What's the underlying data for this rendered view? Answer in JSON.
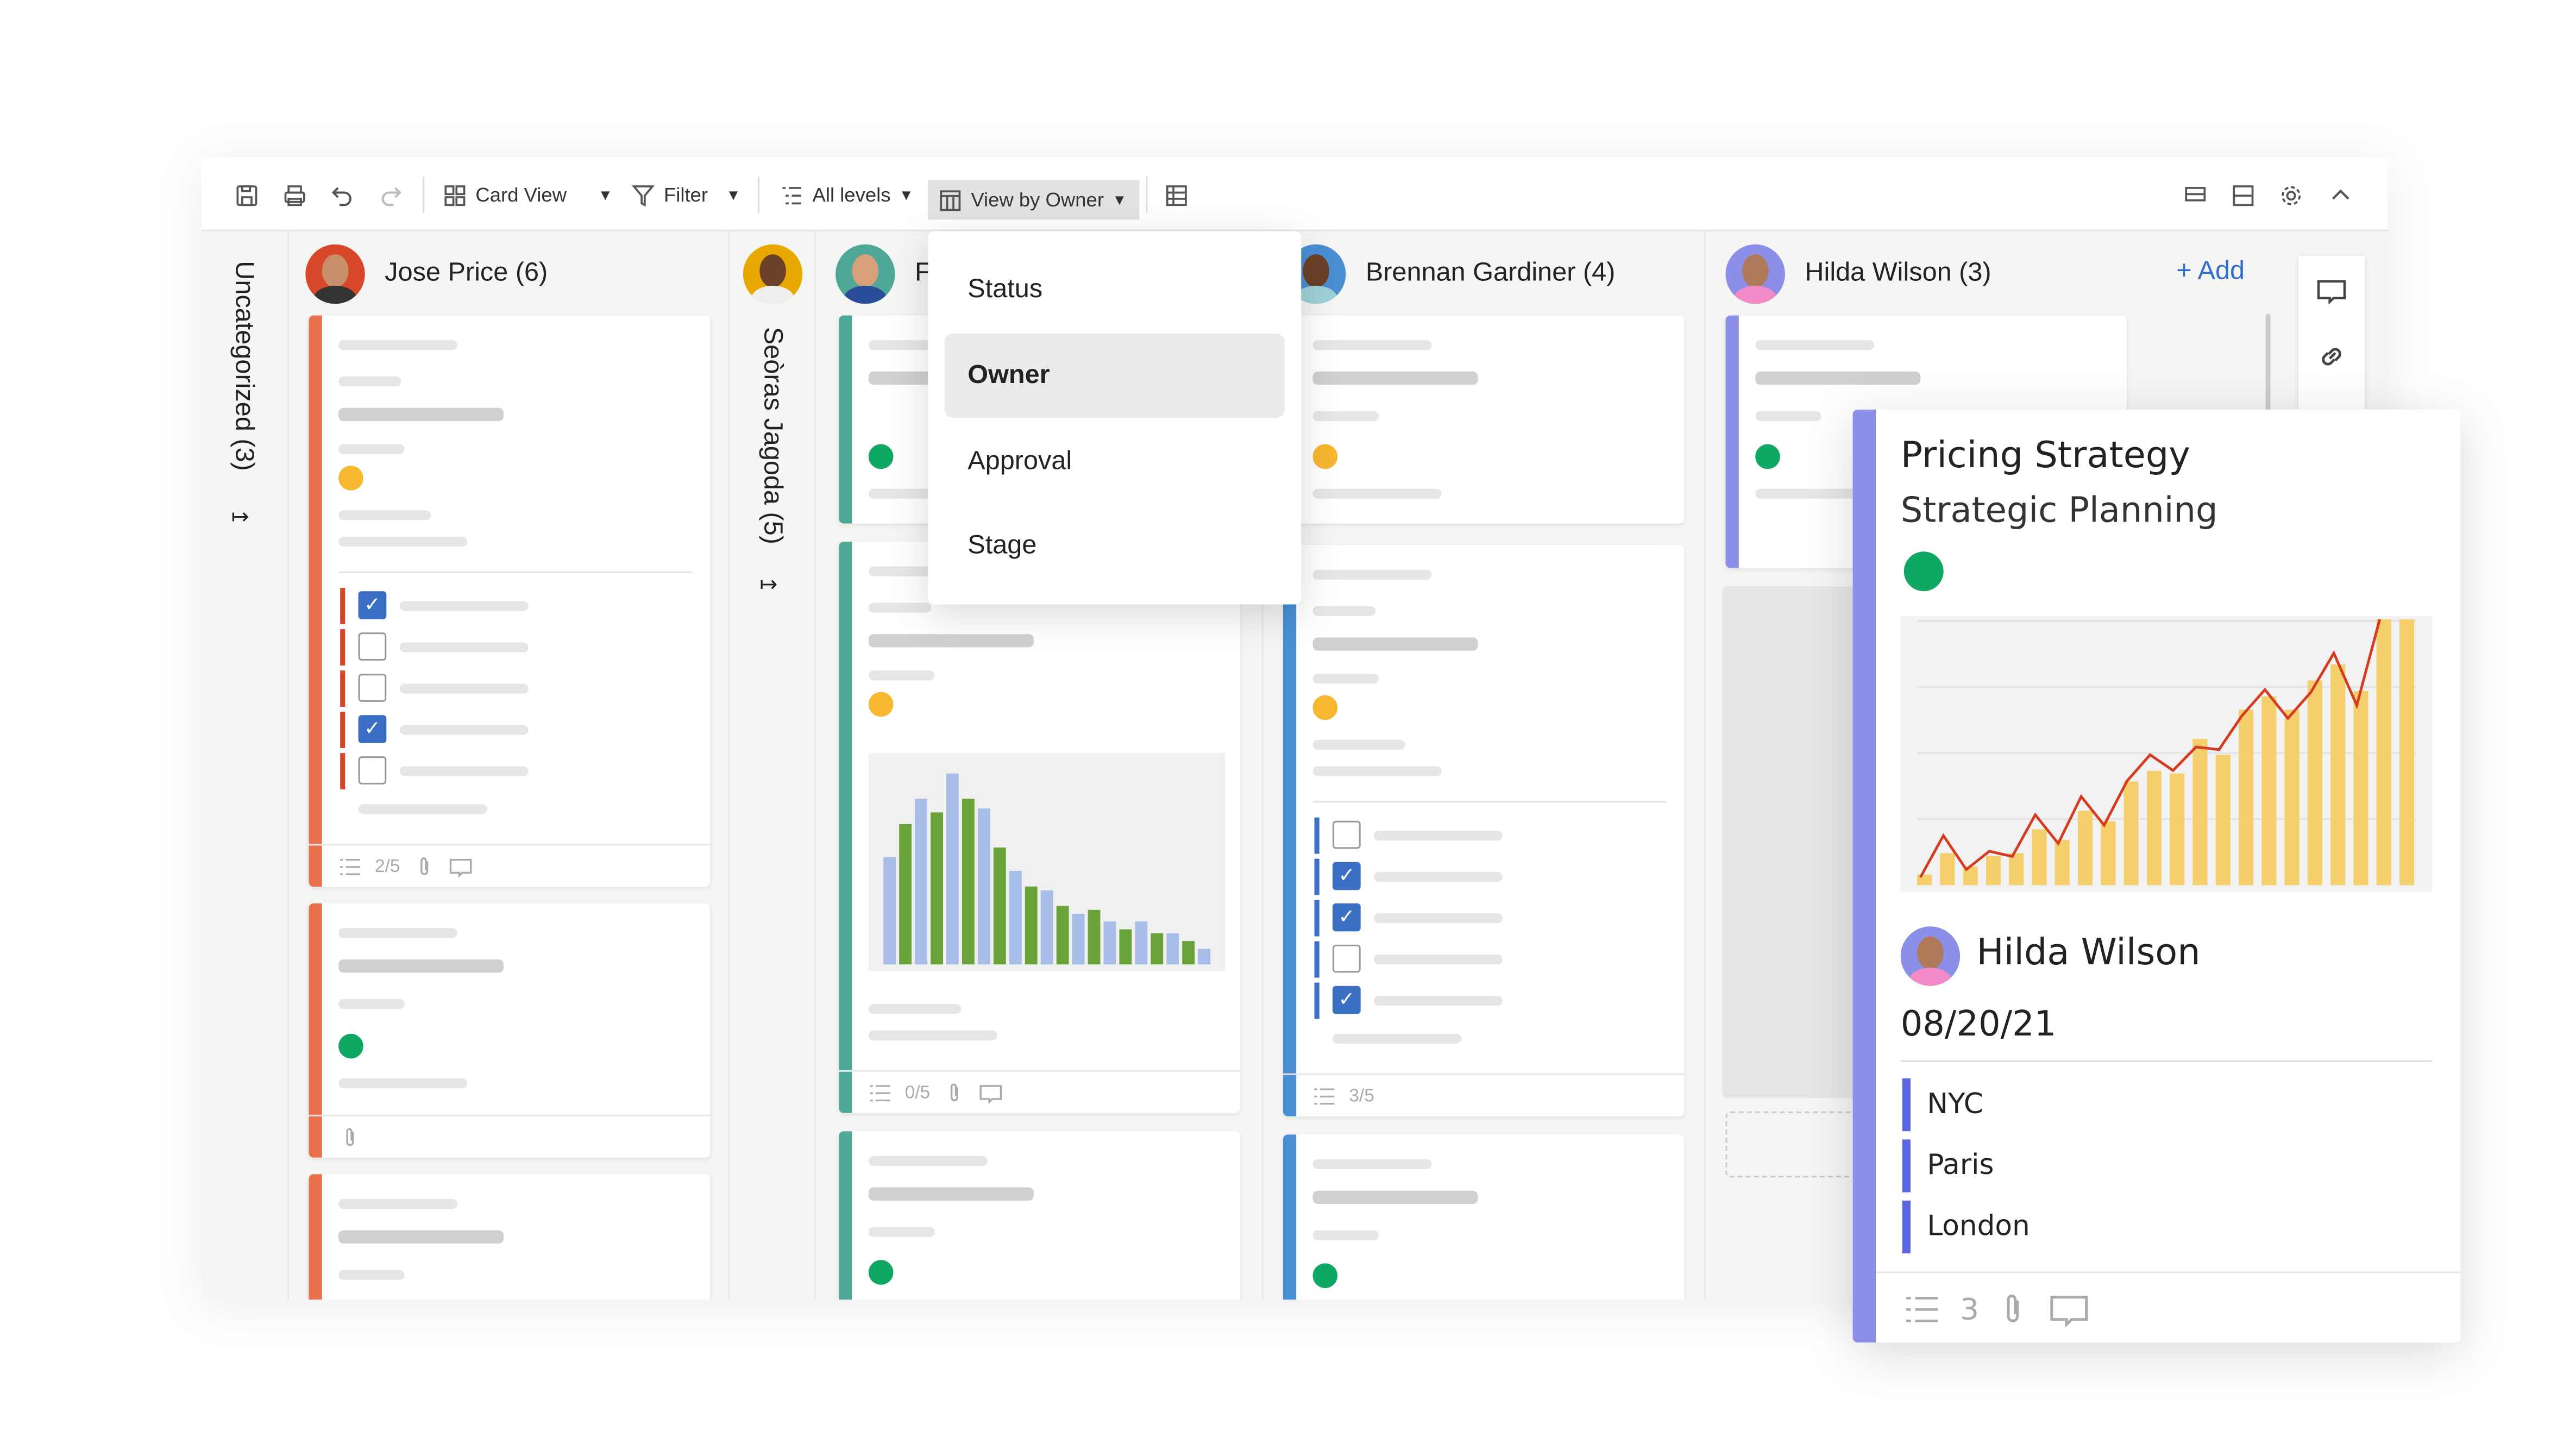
{
  "toolbar": {
    "card_view": "Card View",
    "filter": "Filter",
    "all_levels": "All levels",
    "view_by": "View by Owner"
  },
  "columns": {
    "uncategorized": "Uncategorized (3)",
    "jose": {
      "name": "Jose Price (6)",
      "footer_count": "2/5",
      "avatar_color": "#d9472b"
    },
    "seoras": {
      "name": "Seòras Jagoda (5)",
      "avatar_color": "#e8a800"
    },
    "f": {
      "name": "F",
      "footer_count": "0/5",
      "avatar_color": "#4fa897"
    },
    "brennan": {
      "name": "Brennan Gardiner (4)",
      "footer_count": "3/5",
      "avatar_color": "#4a8fd4"
    },
    "hilda": {
      "name": "Hilda Wilson (3)",
      "avatar_color": "#8b8fe8"
    }
  },
  "add_label": "+ Add",
  "dropdown": {
    "options": [
      "Status",
      "Owner",
      "Approval",
      "Stage"
    ],
    "selected": "Owner"
  },
  "popup": {
    "title": "Pricing Strategy",
    "subtitle": "Strategic Planning",
    "status_color": "#0ea864",
    "owner": "Hilda Wilson",
    "date": "08/20/21",
    "locations": [
      "NYC",
      "Paris",
      "London"
    ],
    "checklist_count": "3",
    "chart": {
      "bars": [
        4,
        12,
        7,
        11,
        12,
        21,
        17,
        28,
        24,
        39,
        43,
        42,
        55,
        49,
        66,
        71,
        66,
        77,
        83,
        73,
        100,
        100
      ],
      "line": [
        3,
        19,
        6,
        13,
        11,
        27,
        16,
        34,
        23,
        40,
        50,
        44,
        53,
        52,
        65,
        75,
        64,
        74,
        89,
        69,
        102
      ]
    }
  },
  "mini_chart": {
    "values": [
      55,
      72,
      85,
      78,
      98,
      85,
      80,
      60,
      48,
      40,
      38,
      30,
      26,
      28,
      22,
      18,
      22,
      16,
      16,
      12,
      8
    ],
    "series_colors": [
      "#a8bde8",
      "#6aa33a"
    ]
  },
  "colors": {
    "jose": "#e8704a",
    "f": "#4fa897",
    "brennan": "#4a8fd4",
    "hilda": "#8b8fe8",
    "checkbox": "#3a6fc4"
  }
}
